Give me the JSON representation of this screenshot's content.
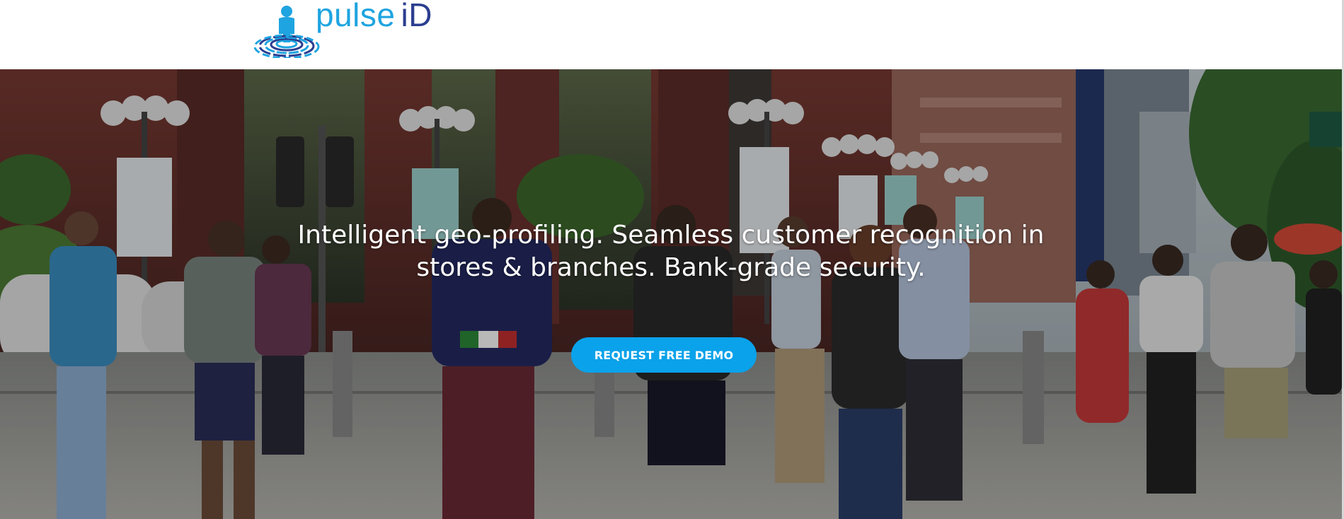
{
  "header": {
    "logo": {
      "word_1": "pulse",
      "word_2": "iD",
      "icon": "person-fingerprint-icon",
      "color_primary": "#1ea4e0",
      "color_secondary": "#2b3e8f"
    }
  },
  "hero": {
    "background": "busy-city-street-photo",
    "title": "Intelligent geo-profiling. Seamless customer recognition in stores & branches. Bank-grade security.",
    "cta_label": "REQUEST FREE DEMO",
    "cta_color": "#0aa2ea"
  }
}
